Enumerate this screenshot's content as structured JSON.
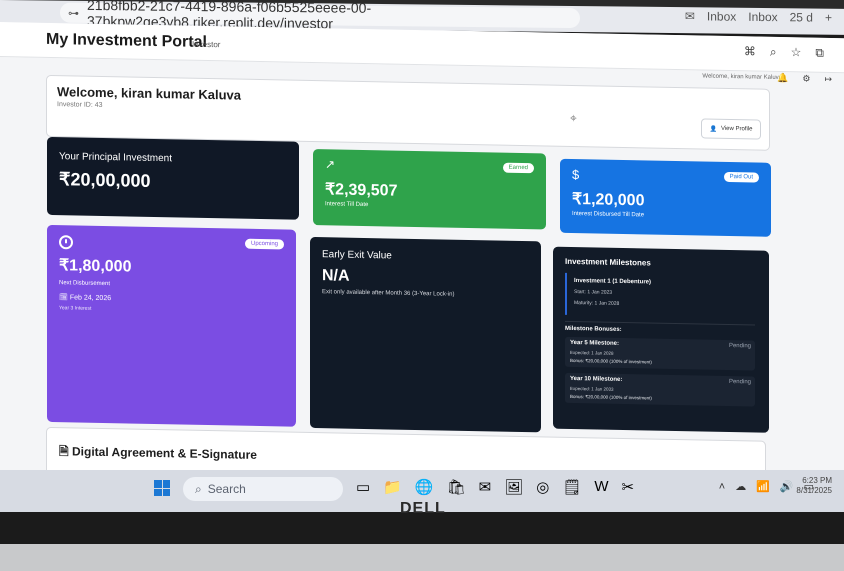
{
  "browser": {
    "url": "21b8fbb2-21c7-4419-896a-f06b5525eeee-00-37bkpw2ge3yb8.riker.replit.dev/investor",
    "tabs_right": [
      "Inbox",
      "Inbox",
      "25 d"
    ]
  },
  "app": {
    "title": "My Investment Portal",
    "subtitle": "Investor",
    "welcome_text": "Welcome, kiran kumar Kaluva",
    "welcome_card_title": "Welcome, kiran kumar Kaluva",
    "investor_id": "Investor ID: 43",
    "view_profile": "View Profile"
  },
  "cards": {
    "principal_label": "Your Principal Investment",
    "principal_value": "₹20,00,000",
    "interest_value": "₹2,39,507",
    "interest_label": "Interest Till Date",
    "interest_badge": "Earned",
    "disbursed_value": "₹1,20,000",
    "disbursed_label": "Interest Disbursed Till Date",
    "disbursed_badge": "Paid Out",
    "next_badge": "Upcoming",
    "next_value": "₹1,80,000",
    "next_label": "Next Disbursement",
    "next_date": "Feb 24, 2026",
    "next_year": "Year 3 Interest",
    "early_title": "Early Exit Value",
    "early_value": "N/A",
    "early_note": "Exit only available after Month 36 (3-Year Lock-in)"
  },
  "milestones": {
    "title": "Investment Milestones",
    "investment": "Investment 1 (1 Debenture)",
    "start": "Start: 1 Jan 2023",
    "maturity": "Maturity: 1 Jan 2028",
    "bonuses_title": "Milestone Bonuses:",
    "bonus1_name": "Year 5 Milestone:",
    "bonus1_status": "Pending",
    "bonus1_expected": "Expected: 1 Jan 2028",
    "bonus1_amount": "Bonus: ₹20,00,000 (100% of investment)",
    "bonus2_name": "Year 10 Milestone:",
    "bonus2_status": "Pending",
    "bonus2_expected": "Expected: 1 Jan 2033",
    "bonus2_amount": "Bonus: ₹20,00,000 (100% of investment)"
  },
  "agreement": {
    "title": "Digital Agreement & E-Signature"
  },
  "taskbar": {
    "search_placeholder": "Search",
    "time": "6:23 PM",
    "date": "8/31/2025"
  },
  "laptop": {
    "brand": "DELL"
  }
}
